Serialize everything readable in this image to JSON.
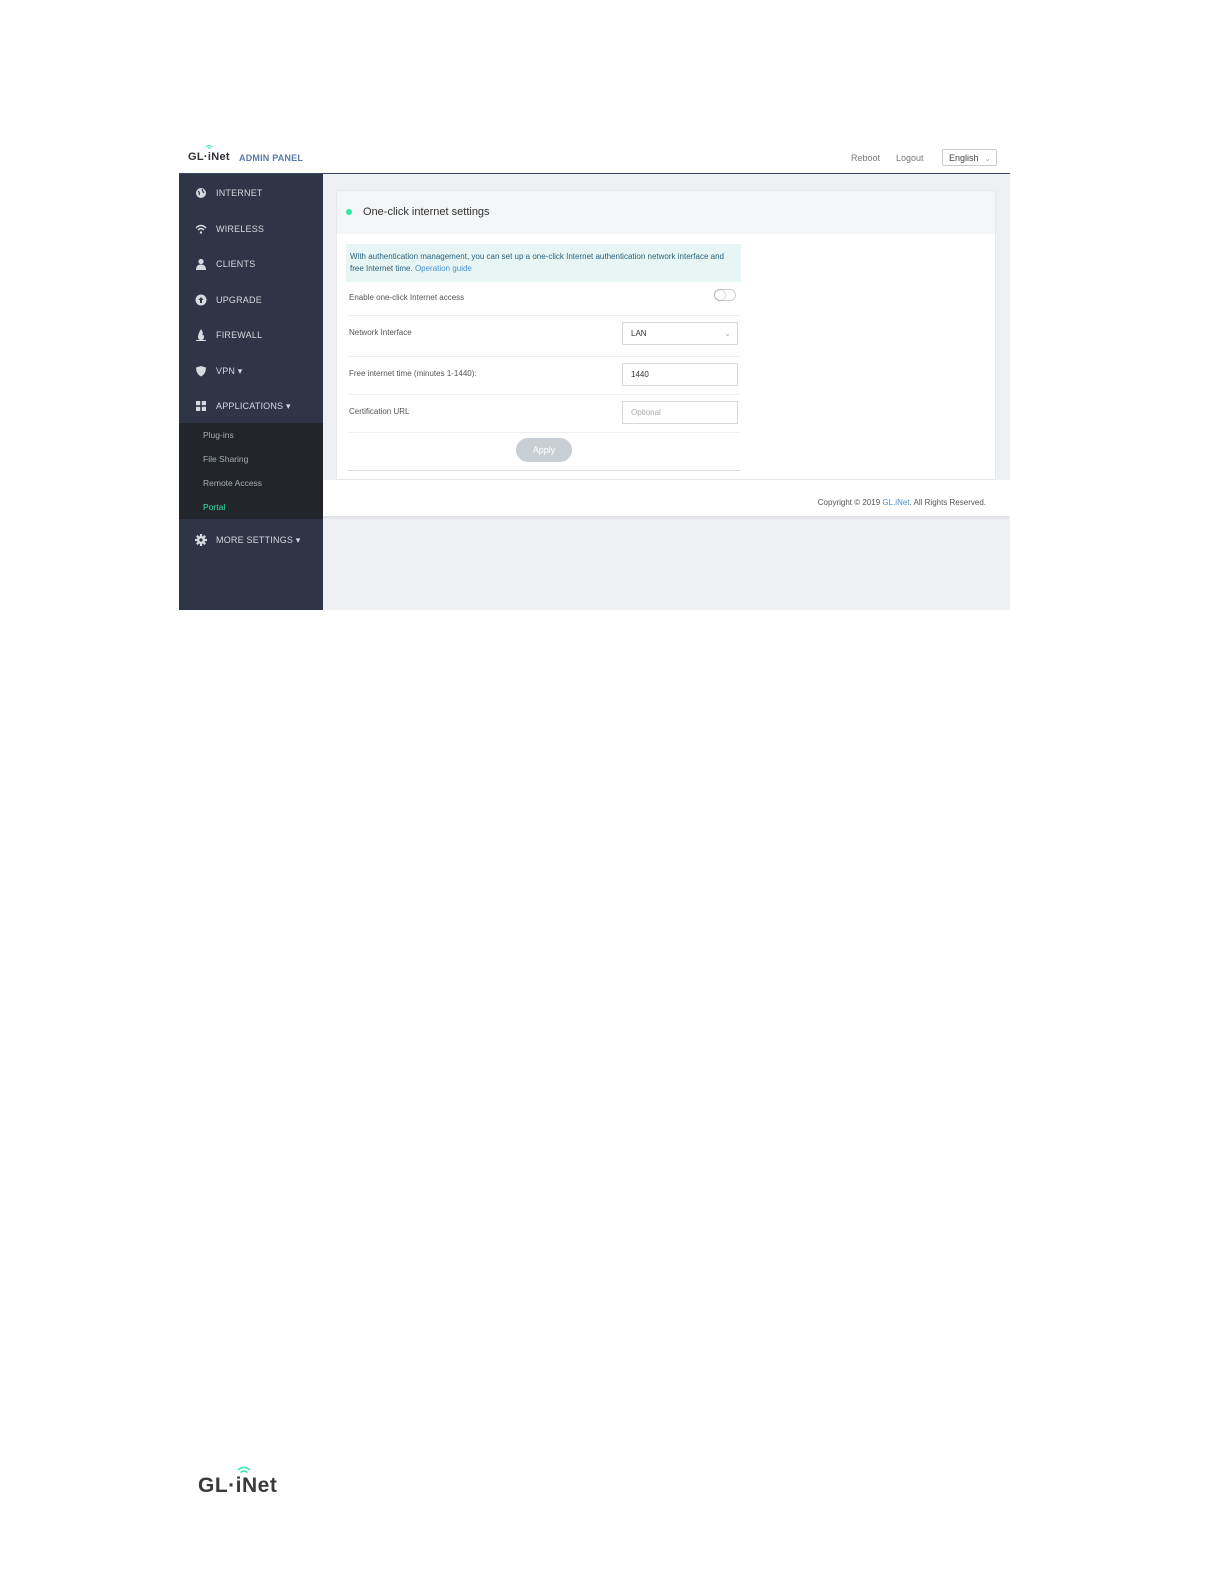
{
  "brand": {
    "name": "GL·iNet",
    "panel": "ADMIN PANEL"
  },
  "topbar": {
    "reboot": "Reboot",
    "logout": "Logout",
    "language": "English"
  },
  "sidebar": {
    "items": [
      {
        "label": "INTERNET",
        "icon": "globe-icon"
      },
      {
        "label": "WIRELESS",
        "icon": "wifi-icon"
      },
      {
        "label": "CLIENTS",
        "icon": "user-icon"
      },
      {
        "label": "UPGRADE",
        "icon": "upload-icon"
      },
      {
        "label": "FIREWALL",
        "icon": "flame-icon"
      },
      {
        "label": "VPN ▾",
        "icon": "shield-icon"
      },
      {
        "label": "APPLICATIONS ▾",
        "icon": "grid-icon"
      },
      {
        "label": "MORE SETTINGS ▾",
        "icon": "gear-icon"
      }
    ],
    "submenu": [
      "Plug-ins",
      "File Sharing",
      "Remote Access",
      "Portal"
    ],
    "active_submenu": "Portal"
  },
  "card": {
    "title": "One-click internet settings",
    "info_text": "With authentication management, you can set up a one-click Internet authentication network interface and free Internet time.",
    "info_link": "Operation guide",
    "fields": {
      "enable_label": "Enable one-click Internet access",
      "interface_label": "Network Interface",
      "interface_value": "LAN",
      "time_label": "Free internet time (minutes 1-1440):",
      "time_value": "1440",
      "url_label": "Certification URL",
      "url_placeholder": "Optional"
    },
    "apply": "Apply",
    "enable_on": false
  },
  "copyright": {
    "prefix": "Copyright © 2019 ",
    "company": "GL.iNet",
    "suffix": ". All Rights Reserved."
  },
  "footer_logo": "GL·iNet",
  "colors": {
    "accent": "#2ee8a6",
    "sidebar": "#2f3446",
    "submenu": "#222529",
    "link": "#4a8fc8"
  }
}
